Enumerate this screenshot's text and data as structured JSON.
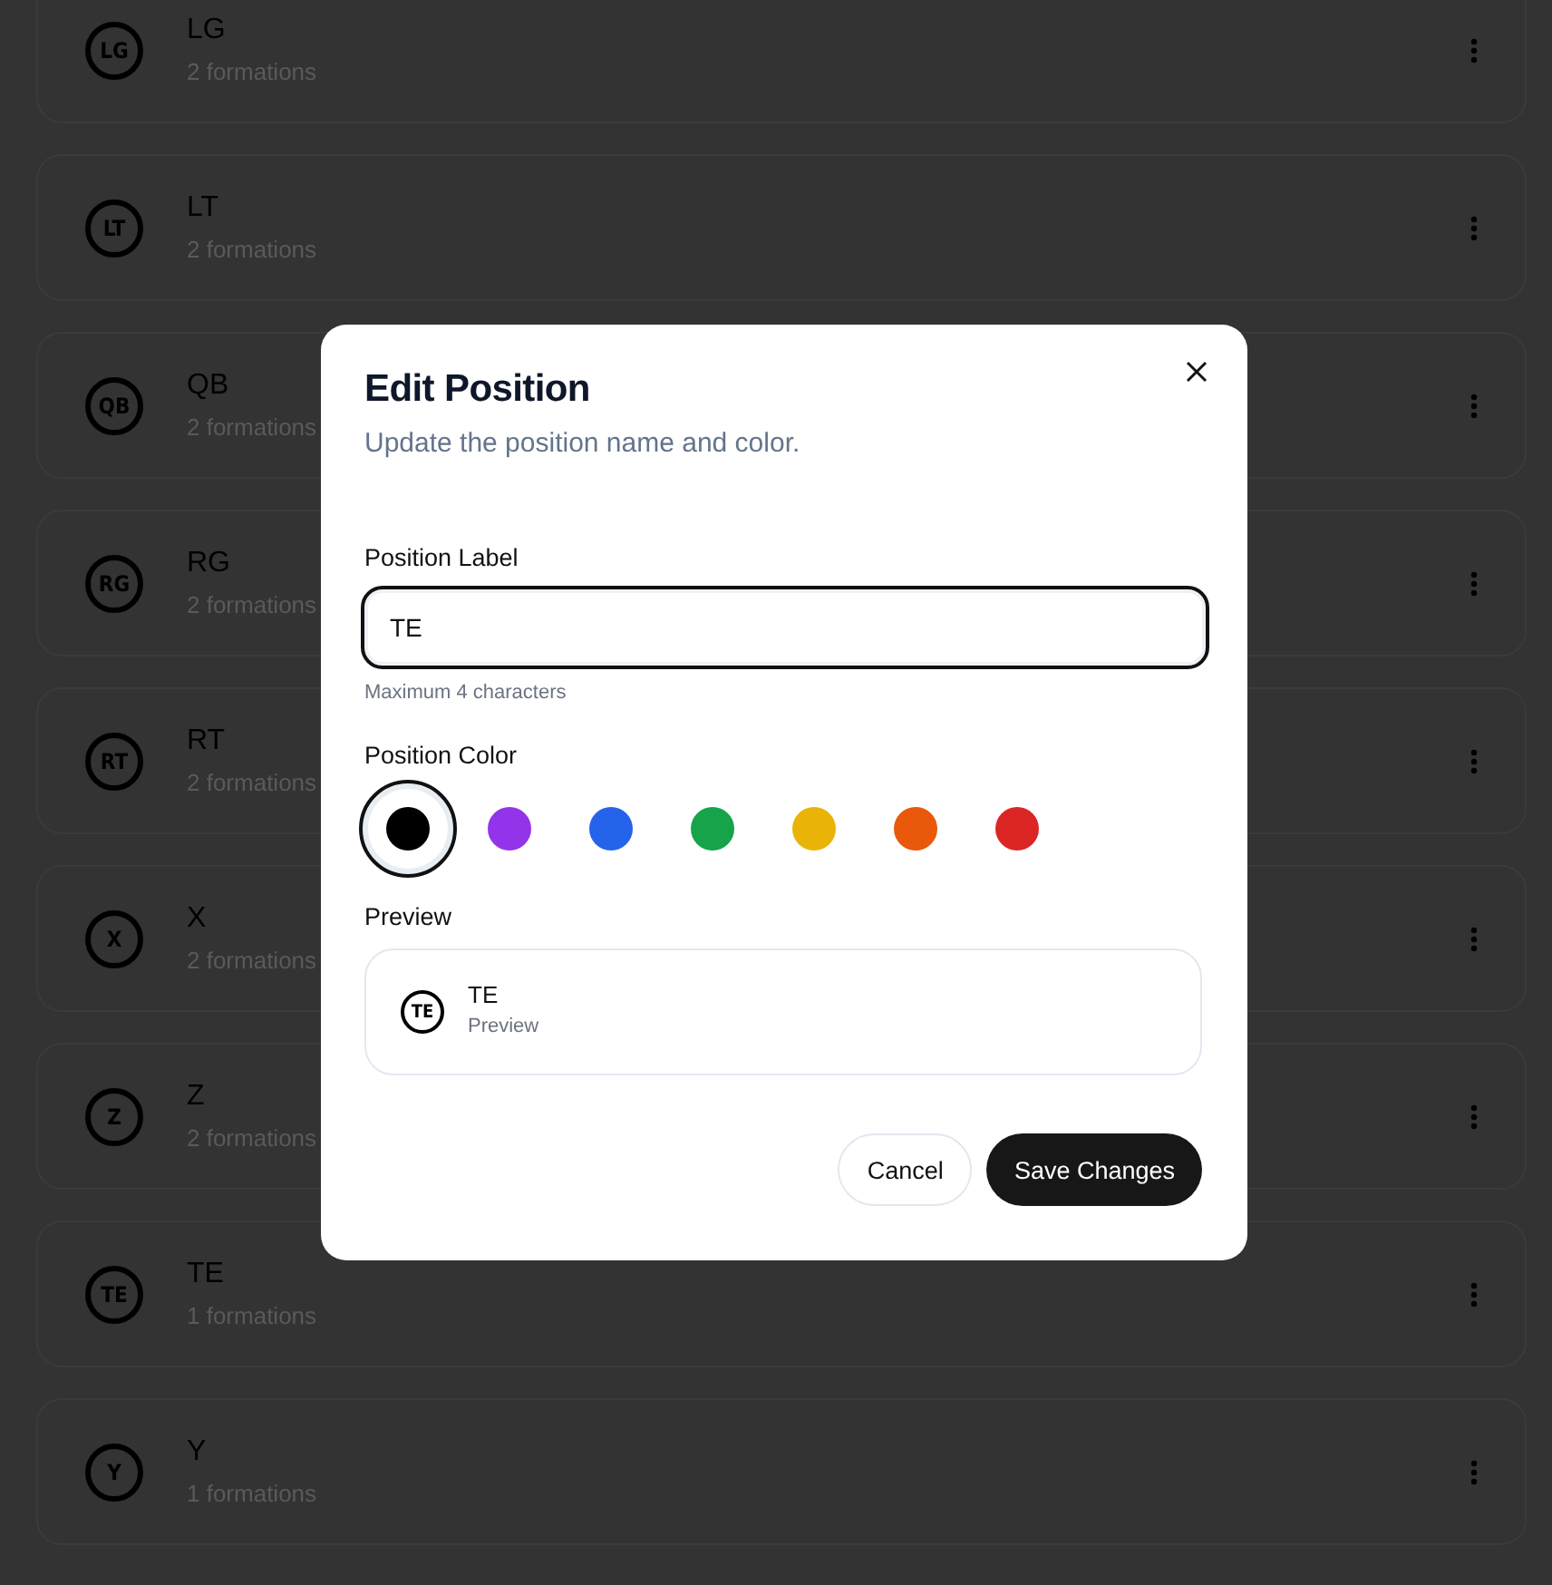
{
  "positions": [
    {
      "badge": "LG",
      "label": "LG",
      "count": "2 formations"
    },
    {
      "badge": "LT",
      "label": "LT",
      "count": "2 formations"
    },
    {
      "badge": "QB",
      "label": "QB",
      "count": "2 formations"
    },
    {
      "badge": "RG",
      "label": "RG",
      "count": "2 formations"
    },
    {
      "badge": "RT",
      "label": "RT",
      "count": "2 formations"
    },
    {
      "badge": "X",
      "label": "X",
      "count": "2 formations"
    },
    {
      "badge": "Z",
      "label": "Z",
      "count": "2 formations"
    },
    {
      "badge": "TE",
      "label": "TE",
      "count": "1 formations"
    },
    {
      "badge": "Y",
      "label": "Y",
      "count": "1 formations"
    }
  ],
  "dialog": {
    "title": "Edit Position",
    "description": "Update the position name and color.",
    "label_field": {
      "label": "Position Label",
      "value": "TE",
      "hint": "Maximum 4 characters"
    },
    "color_label": "Position Color",
    "colors": [
      {
        "color": "#000000",
        "selected": true
      },
      {
        "color": "#9333ea",
        "selected": false
      },
      {
        "color": "#2563eb",
        "selected": false
      },
      {
        "color": "#16a34a",
        "selected": false
      },
      {
        "color": "#eab308",
        "selected": false
      },
      {
        "color": "#ea580c",
        "selected": false
      },
      {
        "color": "#dc2626",
        "selected": false
      }
    ],
    "preview_label": "Preview",
    "preview": {
      "badge": "TE",
      "label": "TE",
      "subtitle": "Preview"
    },
    "buttons": [
      {
        "label": "Cancel",
        "kind": "secondary"
      },
      {
        "label": "Save Changes",
        "kind": "primary"
      }
    ]
  }
}
